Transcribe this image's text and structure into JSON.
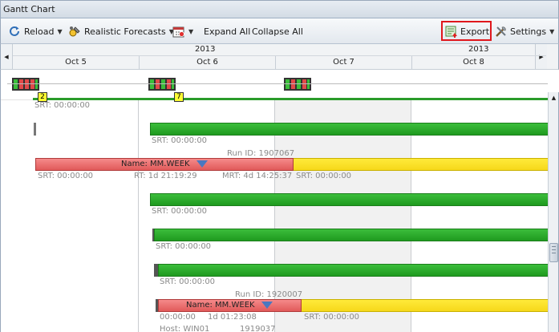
{
  "window": {
    "title": "Gantt Chart"
  },
  "toolbar": {
    "reload_label": "Reload",
    "forecasts_label": "Realistic Forecasts",
    "expand_label": "Expand All",
    "collapse_label": "Collapse All",
    "export_label": "Export",
    "settings_label": "Settings",
    "highlight_color": "#e0171c"
  },
  "timescale": {
    "years": [
      "2013",
      "2013"
    ],
    "days": [
      "Oct 5",
      "Oct 6",
      "Oct 7",
      "Oct 8"
    ]
  },
  "badges": [
    "2",
    "7"
  ],
  "labels": {
    "srt_1": "SRT: 00:00:00",
    "srt_2": "SRT: 00:00:00",
    "run_id_1": "Run ID: 1907067",
    "name_1": "Name: MM.WEEK",
    "srt_3": "SRT: 00:00:00",
    "rt_1": "RT: 1d 21:19:29",
    "mrt_1": "MRT: 4d 14:25:37",
    "srt_4": "SRT: 00:00:00",
    "srt_5": "SRT: 00:00:00",
    "srt_6": "SRT: 00:00:00",
    "srt_7": "SRT: 00:00:00",
    "run_id_2": "Run ID: 1920007",
    "name_2": "Name: MM.WEEK",
    "srt_8": "00:00:00",
    "rt_2": "1d 01:23:08",
    "srt_9": "SRT: 00:00:00",
    "host": "Host: WIN01",
    "run_id_3": "1919037"
  },
  "colors": {
    "bar_green": "#2aa82a",
    "bar_red": "#e86a6a",
    "bar_yellow": "#f8dc22"
  }
}
